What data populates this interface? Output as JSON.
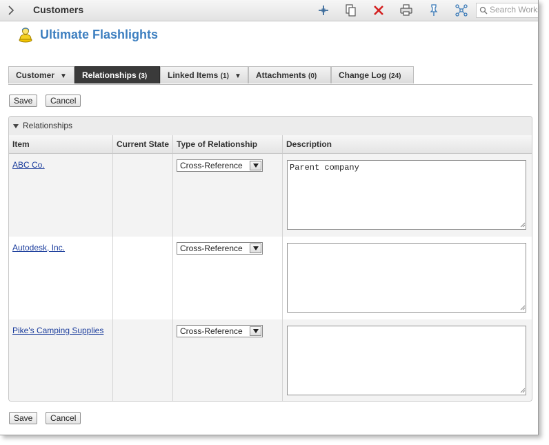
{
  "header": {
    "title": "Customers",
    "search": {
      "placeholder": "Search Workspace",
      "value": ""
    },
    "tools": [
      "add-icon",
      "clone-icon",
      "delete-icon",
      "print-icon",
      "bookmark-icon",
      "workflow-icon"
    ]
  },
  "item": {
    "title": "Ultimate Flashlights",
    "icon": "customer-icon"
  },
  "tabs": [
    {
      "label": "Customer",
      "count": "",
      "has_dropdown": true,
      "active": false
    },
    {
      "label": "Relationships",
      "count": "(3)",
      "has_dropdown": false,
      "active": true
    },
    {
      "label": "Linked Items",
      "count": "(1)",
      "has_dropdown": true,
      "active": false
    },
    {
      "label": "Attachments",
      "count": "(0)",
      "has_dropdown": false,
      "active": false
    },
    {
      "label": "Change Log",
      "count": "(24)",
      "has_dropdown": false,
      "active": false
    }
  ],
  "actions": {
    "save_label": "Save",
    "cancel_label": "Cancel"
  },
  "panel": {
    "title": "Relationships",
    "columns": [
      "Item",
      "Current State",
      "Type of Relationship",
      "Description"
    ],
    "rows": [
      {
        "item": "ABC Co.",
        "state": "",
        "type": "Cross-Reference",
        "description": "Parent company"
      },
      {
        "item": "Autodesk, Inc.",
        "state": "",
        "type": "Cross-Reference",
        "description": ""
      },
      {
        "item": "Pike's Camping Supplies",
        "state": "",
        "type": "Cross-Reference",
        "description": ""
      }
    ]
  },
  "colors": {
    "title_blue": "#3d7fc0",
    "active_tab": "#3a3a3a",
    "link": "#1a3c9c",
    "delete_red": "#d42020"
  }
}
